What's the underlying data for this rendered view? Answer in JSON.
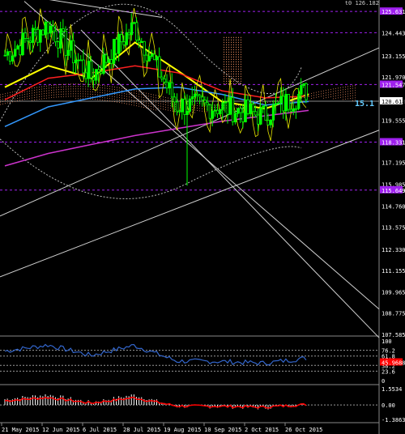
{
  "header_value": "t0 126.182",
  "colors": {
    "background": "#000000",
    "grid": "#555555",
    "axis_text": "#ffffff",
    "candle": "#00ff00",
    "ma_fast_yellow": "#ffff00",
    "ma_red": "#ff2020",
    "ma_blue": "#3399ff",
    "ma_purple": "#cc33cc",
    "ichimoku_cloud": "#ff9966",
    "price_tag_current": "#ffffff",
    "level_tag": "#a020f0",
    "rsi_line": "#3366cc",
    "macd_signal": "#ff0000",
    "macd_hist": "#ffffff"
  },
  "price_axis": {
    "labels": [
      "124.443",
      "123.155",
      "121.970",
      "120.618",
      "119.555",
      "118.331",
      "117.195",
      "115.985",
      "115.649",
      "114.760",
      "113.575",
      "112.330",
      "111.155",
      "109.965",
      "108.775",
      "107.585"
    ],
    "highlight_labels": [
      "125.631",
      "121.547",
      "118.331",
      "115.649"
    ],
    "current_price": "120.618"
  },
  "chart_text": {
    "cloud_label": "15.1"
  },
  "rsi_axis": {
    "labels": [
      "100",
      "76.2",
      "61.8",
      "38.2",
      "23.6",
      "0"
    ],
    "tag": "45.9688"
  },
  "macd_axis": {
    "labels": [
      "1.5534",
      "0.00",
      "-1.3863"
    ]
  },
  "time_axis": {
    "labels": [
      "21 May 2015",
      "12 Jun 2015",
      "6 Jul 2015",
      "28 Jul 2015",
      "19 Aug 2015",
      "10 Sep 2015",
      "2 Oct 2015",
      "26 Oct 2015"
    ]
  },
  "chart_data": {
    "type": "candlestick",
    "title": "",
    "x": [
      "21 May 2015",
      "12 Jun 2015",
      "6 Jul 2015",
      "28 Jul 2015",
      "19 Aug 2015",
      "10 Sep 2015",
      "2 Oct 2015",
      "26 Oct 2015"
    ],
    "close_trend": [
      123.2,
      124.9,
      122.0,
      124.8,
      120.4,
      120.3,
      119.8,
      121.2
    ],
    "ylim": [
      107.585,
      126.182
    ],
    "rsi_ylim": [
      0,
      100
    ],
    "macd_ylim": [
      -1.3863,
      1.5534
    ],
    "series": [
      {
        "name": "",
        "values": [
          121.4,
          122.6,
          121.9,
          123.9,
          122.3,
          120.6,
          120.2,
          121.0
        ]
      },
      {
        "name": "",
        "values": [
          120.7,
          121.9,
          122.2,
          122.6,
          122.2,
          121.2,
          120.8,
          120.9
        ]
      },
      {
        "name": "",
        "values": [
          119.2,
          120.3,
          120.8,
          121.3,
          121.4,
          121.0,
          120.4,
          120.6
        ]
      },
      {
        "name": "",
        "values": [
          117.0,
          117.7,
          118.2,
          118.7,
          119.1,
          119.5,
          119.8,
          120.1
        ]
      }
    ]
  }
}
